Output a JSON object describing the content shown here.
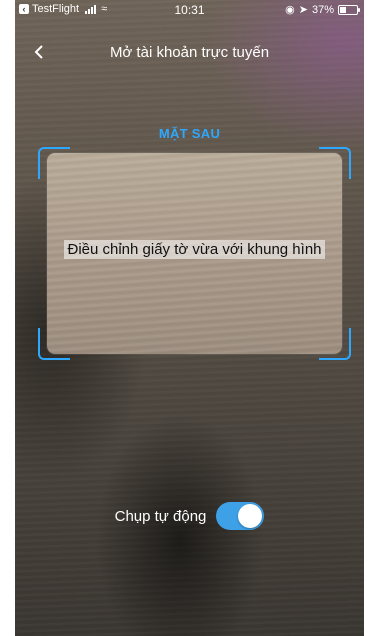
{
  "status_bar": {
    "app_back": "TestFlight",
    "time": "10:31",
    "battery": "37%"
  },
  "nav": {
    "title": "Mở tài khoản trực tuyến"
  },
  "capture": {
    "side_label": "MẶT SAU",
    "hint": "Điều chỉnh giấy tờ vừa với khung hình"
  },
  "auto_capture": {
    "label": "Chụp tự động",
    "enabled": true
  },
  "colors": {
    "accent": "#2ea8ff",
    "toggle_on": "#3ea0e6"
  }
}
